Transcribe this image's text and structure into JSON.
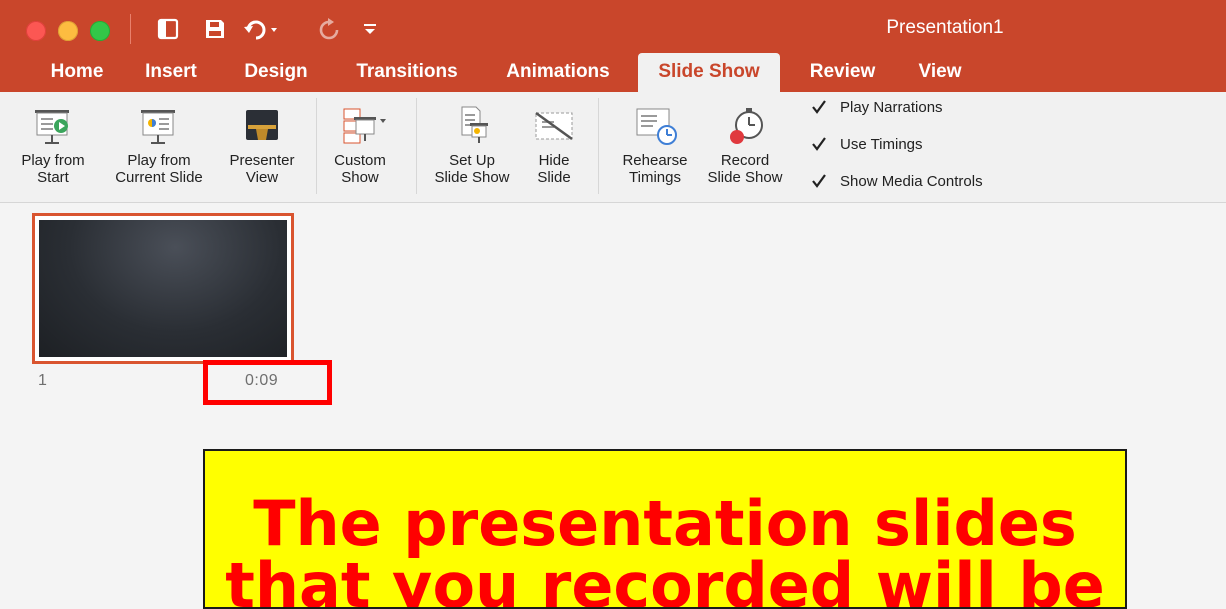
{
  "window": {
    "title": "Presentation1"
  },
  "tabs": [
    {
      "label": "Home",
      "active": false
    },
    {
      "label": "Insert",
      "active": false
    },
    {
      "label": "Design",
      "active": false
    },
    {
      "label": "Transitions",
      "active": false
    },
    {
      "label": "Animations",
      "active": false
    },
    {
      "label": "Slide Show",
      "active": true
    },
    {
      "label": "Review",
      "active": false
    },
    {
      "label": "View",
      "active": false
    }
  ],
  "ribbon": {
    "play_from_start": [
      "Play from",
      "Start"
    ],
    "play_from_current": [
      "Play from",
      "Current Slide"
    ],
    "presenter_view": [
      "Presenter",
      "View"
    ],
    "custom_show": [
      "Custom",
      "Show"
    ],
    "set_up_slide_show": [
      "Set Up",
      "Slide Show"
    ],
    "hide_slide": [
      "Hide",
      "Slide"
    ],
    "rehearse_timings": [
      "Rehearse",
      "Timings"
    ],
    "record_slide_show": [
      "Record",
      "Slide Show"
    ],
    "checkboxes": [
      {
        "label": "Play Narrations",
        "checked": true
      },
      {
        "label": "Use Timings",
        "checked": true
      },
      {
        "label": "Show Media Controls",
        "checked": true
      }
    ]
  },
  "slides": [
    {
      "number": "1",
      "timing": "0:09"
    }
  ],
  "annotation": {
    "text_line1": "The presentation slides",
    "text_line2": "that you recorded will be",
    "color": "#ff0000",
    "background": "#ffff00"
  },
  "colors": {
    "accent": "#c9462b",
    "highlight": "#ff0000"
  }
}
